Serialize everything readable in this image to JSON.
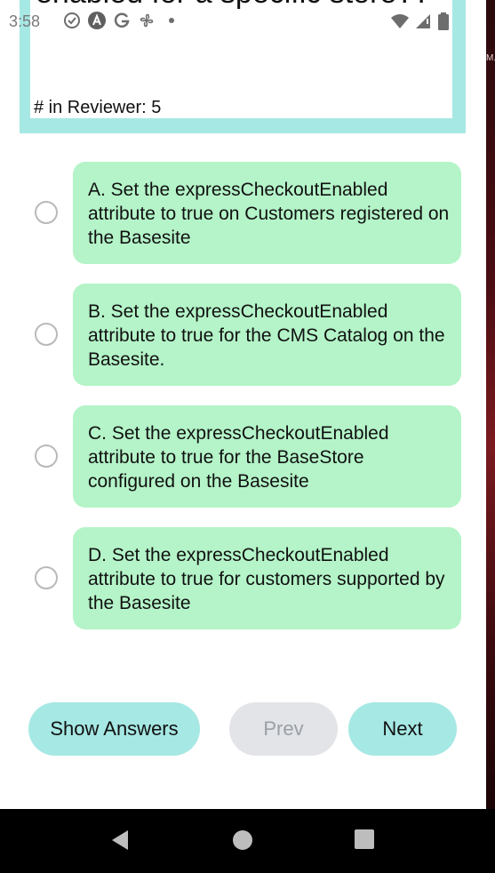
{
  "status_bar": {
    "time": "3:58",
    "left_icons": [
      "check-circle-icon",
      "a-circle-icon",
      "g-icon",
      "fan-icon",
      "dot-icon"
    ],
    "right_icons": [
      "wifi-icon",
      "signal-icon",
      "battery-icon"
    ]
  },
  "side_strip_text": "M.",
  "question": {
    "text_visible": "enabled for a specific store??",
    "reviewer_count": "# in Reviewer: 5"
  },
  "options": [
    {
      "text": "A. Set the expressCheckoutEnabled attribute to true on Customers registered on the Basesite"
    },
    {
      "text": "B. Set the expressCheckoutEnabled attribute to true for the CMS Catalog on the Basesite."
    },
    {
      "text": "C. Set the expressCheckoutEnabled attribute to true for the BaseStore configured on the Basesite"
    },
    {
      "text": "D. Set the expressCheckoutEnabled attribute to true for customers supported by the Basesite"
    }
  ],
  "buttons": {
    "show_answers": "Show Answers",
    "prev": "Prev",
    "next": "Next"
  },
  "colors": {
    "accent": "#a6e8e4",
    "option_bg": "#b4f4c8",
    "disabled_bg": "#e2e4e7",
    "disabled_text": "#9aa0a6"
  },
  "nav_bar": {
    "icons": [
      "back-icon",
      "home-icon",
      "recents-icon"
    ]
  }
}
